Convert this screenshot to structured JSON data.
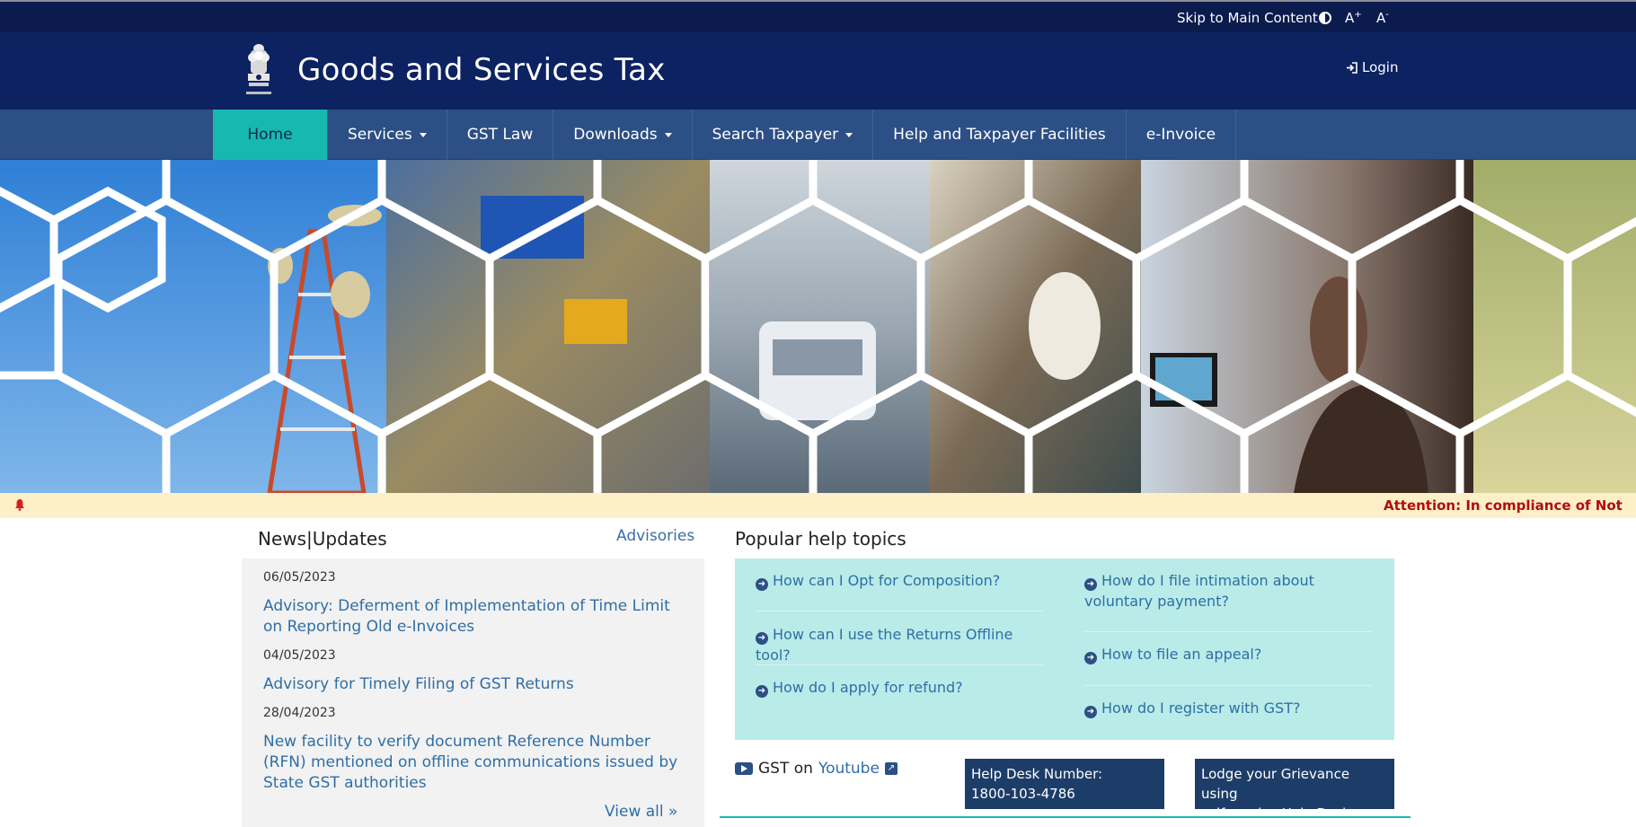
{
  "topbar": {
    "skip_label": "Skip to Main Content",
    "a_plus": "A",
    "a_plus_sup": "+",
    "a_minus": "A",
    "a_minus_sup": "-"
  },
  "header": {
    "title": "Goods and Services Tax",
    "login_label": "Login"
  },
  "nav": {
    "items": [
      {
        "label": "Home",
        "dropdown": false,
        "active": true
      },
      {
        "label": "Services",
        "dropdown": true
      },
      {
        "label": "GST Law",
        "dropdown": false
      },
      {
        "label": "Downloads",
        "dropdown": true
      },
      {
        "label": "Search Taxpayer",
        "dropdown": true
      },
      {
        "label": "Help and Taxpayer Facilities",
        "dropdown": false
      },
      {
        "label": "e-Invoice",
        "dropdown": false
      }
    ]
  },
  "ticker": {
    "text": "Attention: In compliance of Not"
  },
  "news": {
    "title": "News|Updates",
    "advisories_label": "Advisories",
    "items": [
      {
        "date": "06/05/2023",
        "title": "Advisory: Deferment of Implementation of Time Limit on Reporting Old e-Invoices"
      },
      {
        "date": "04/05/2023",
        "title": "Advisory for Timely Filing of GST Returns"
      },
      {
        "date": "28/04/2023",
        "title": "New facility to verify document Reference Number (RFN) mentioned on offline communications issued by State GST authorities"
      }
    ],
    "view_all": "View all »"
  },
  "help": {
    "title": "Popular help topics",
    "left": [
      "How can I Opt for Composition?",
      "How can I use the Returns Offline tool?",
      "How do I apply for refund?"
    ],
    "right": [
      "How do I file intimation about voluntary payment?",
      "How to file an appeal?",
      "How do I register with GST?"
    ]
  },
  "youtube": {
    "prefix": "GST on",
    "link": "Youtube"
  },
  "helpdesk": {
    "line1": "Help Desk Number:",
    "line2": "1800-103-4786"
  },
  "grievance": {
    "line1": "Lodge your Grievance using",
    "line2": "self-service Help Desk Portal"
  },
  "colors": {
    "topbar": "#0b1b4d",
    "header": "#0d2261",
    "nav": "#2c4f85",
    "nav_active": "#17b8b0",
    "link": "#2f6ea7",
    "ticker_bg": "#fdf0c8",
    "ticker_text": "#b20d0d",
    "help_bg": "#b9ebe8",
    "box_bg": "#1d3d69"
  }
}
